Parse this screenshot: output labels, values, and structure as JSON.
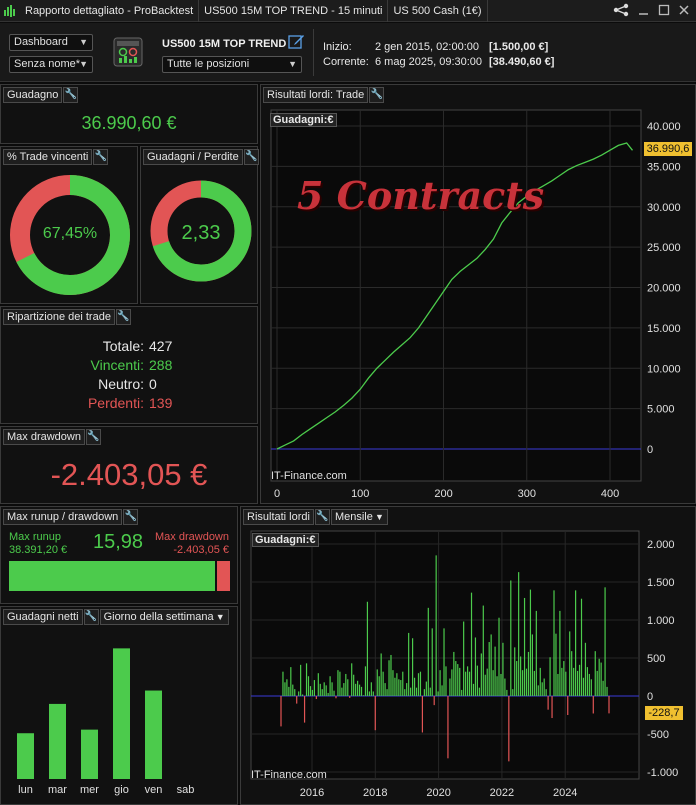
{
  "titlebar": {
    "tabs": [
      "Rapporto dettagliato - ProBacktest",
      "US500 15M TOP TREND - 15 minuti",
      "US 500 Cash (1€)"
    ],
    "logo_icon": "bars-logo-icon",
    "share_icon": "share-icon",
    "minimize_icon": "minimize-icon",
    "maximize_icon": "maximize-icon",
    "close_icon": "close-icon"
  },
  "toolbar": {
    "view_select": "Dashboard",
    "name_select": "Senza nome*",
    "strategy_title": "US500 15M TOP TREND",
    "positions_select": "Tutte le posizioni",
    "start_label": "Inizio:",
    "start_date": "2 gen 2015, 02:00:00",
    "start_amount": "[1.500,00 €]",
    "current_label": "Corrente:",
    "current_date": "6 mag 2025, 09:30:00",
    "current_amount": "[38.490,60 €]"
  },
  "gain": {
    "title": "Guadagno",
    "value": "36.990,60 €"
  },
  "winrate": {
    "title": "% Trade vincenti",
    "value": "67,45%",
    "fraction": 0.6745
  },
  "ratio": {
    "title": "Guadagni / Perdite",
    "value": "2,33",
    "fraction": 0.7
  },
  "breakdown": {
    "title": "Ripartizione dei trade",
    "total_label": "Totale:",
    "total": "427",
    "win_label": "Vincenti:",
    "win": "288",
    "neutral_label": "Neutro:",
    "neutral": "0",
    "loss_label": "Perdenti:",
    "loss": "139"
  },
  "maxdd": {
    "title": "Max drawdown",
    "value": "-2.403,05 €"
  },
  "runup": {
    "title": "Max runup / drawdown",
    "runup_label": "Max runup",
    "runup_value": "38.391,20 €",
    "ratio": "15,98",
    "dd_label": "Max drawdown",
    "dd_value": "-2.403,05 €",
    "runup_fraction": 0.941
  },
  "netgain": {
    "title": "Guadagni netti",
    "mode_select": "Giorno della settimana"
  },
  "equity": {
    "title": "Risultati lordi: Trade",
    "legend": "Guadagni:€",
    "overlay_text": "5 Contracts",
    "watermark": "IT-Finance.com",
    "last_value_label": "36.990,6"
  },
  "monthly": {
    "title": "Risultati lordi",
    "period_select": "Mensile",
    "legend": "Guadagni:€",
    "watermark": "IT-Finance.com",
    "last_value_label": "-228,7"
  },
  "colors": {
    "green": "#4ccb4c",
    "red": "#e25555",
    "zero_line": "#3a3ad8"
  },
  "chart_data": [
    {
      "type": "line",
      "title": "Guadagni:€",
      "xlabel": "",
      "ylabel": "",
      "xlim": [
        0,
        430
      ],
      "ylim": [
        -500,
        40500
      ],
      "x_ticks": [
        0,
        100,
        200,
        300,
        400
      ],
      "y_ticks": [
        0,
        5000,
        10000,
        15000,
        20000,
        25000,
        30000,
        35000,
        40000
      ],
      "y_tick_labels": [
        "0",
        "5.000",
        "10.000",
        "15.000",
        "20.000",
        "25.000",
        "30.000",
        "35.000",
        "40.000"
      ],
      "grid": true,
      "series": [
        {
          "name": "Guadagni:€",
          "x": [
            0,
            10,
            20,
            30,
            40,
            50,
            60,
            70,
            80,
            90,
            100,
            110,
            120,
            130,
            140,
            150,
            160,
            170,
            180,
            190,
            200,
            210,
            220,
            230,
            240,
            250,
            260,
            270,
            280,
            290,
            300,
            310,
            320,
            330,
            340,
            350,
            360,
            370,
            380,
            390,
            400,
            410,
            420,
            427
          ],
          "y": [
            0,
            500,
            1000,
            1800,
            2500,
            3200,
            3900,
            4600,
            5400,
            6300,
            7400,
            8800,
            10000,
            11000,
            12000,
            12900,
            13800,
            15000,
            16500,
            18000,
            19500,
            21000,
            22000,
            22800,
            23600,
            24700,
            26000,
            28000,
            29300,
            30500,
            31300,
            32000,
            32600,
            33200,
            33900,
            34600,
            35100,
            35500,
            35900,
            36400,
            37000,
            37600,
            37900,
            36990
          ]
        }
      ]
    },
    {
      "type": "bar",
      "title": "Guadagni:€",
      "xlabel": "",
      "ylabel": "",
      "xlim": [
        2015,
        2025.45
      ],
      "ylim": [
        -1000,
        2100
      ],
      "x_ticks": [
        2016,
        2018,
        2020,
        2022,
        2024
      ],
      "y_ticks": [
        -1000,
        -500,
        0,
        500,
        1000,
        1500,
        2000
      ],
      "y_tick_labels": [
        "-1.000",
        "-500",
        "0",
        "500",
        "1.000",
        "1.500",
        "2.000"
      ],
      "series": [
        {
          "name": "Guadagni:€",
          "values": [
            -400,
            320,
            180,
            220,
            120,
            380,
            150,
            90,
            -100,
            60,
            410,
            20,
            -350,
            430,
            260,
            130,
            80,
            210,
            -40,
            300,
            160,
            90,
            180,
            140,
            40,
            260,
            180,
            70,
            -30,
            340,
            320,
            110,
            170,
            290,
            220,
            -25,
            430,
            280,
            160,
            200,
            150,
            120,
            10,
            390,
            1240,
            60,
            180,
            60,
            -450,
            350,
            260,
            560,
            320,
            170,
            90,
            470,
            540,
            340,
            240,
            300,
            220,
            210,
            320,
            90,
            170,
            830,
            110,
            760,
            240,
            110,
            300,
            320,
            -480,
            90,
            190,
            1160,
            110,
            890,
            -120,
            1850,
            60,
            340,
            140,
            890,
            390,
            -820,
            230,
            350,
            580,
            460,
            420,
            370,
            80,
            980,
            320,
            390,
            320,
            1360,
            160,
            770,
            400,
            110,
            560,
            1190,
            280,
            360,
            710,
            810,
            340,
            650,
            260,
            1030,
            290,
            700,
            230,
            80,
            -860,
            1520,
            90,
            640,
            460,
            1630,
            520,
            340,
            1290,
            360,
            580,
            1400,
            810,
            330,
            1120,
            140,
            370,
            180,
            230,
            90,
            -180,
            510,
            -290,
            1390,
            820,
            290,
            1120,
            370,
            460,
            320,
            -250,
            850,
            590,
            370,
            1390,
            330,
            410,
            1280,
            240,
            700,
            380,
            290,
            220,
            -230,
            590,
            330,
            490,
            440,
            200,
            1430,
            120,
            -228.7
          ]
        }
      ]
    },
    {
      "type": "bar",
      "title": "",
      "xlabel": "",
      "ylabel": "",
      "categories": [
        "lun",
        "mar",
        "mer",
        "gio",
        "ven",
        "sab"
      ],
      "values": [
        4450,
        7300,
        4800,
        12700,
        8600,
        0
      ],
      "ylim": [
        0,
        14000
      ]
    }
  ]
}
